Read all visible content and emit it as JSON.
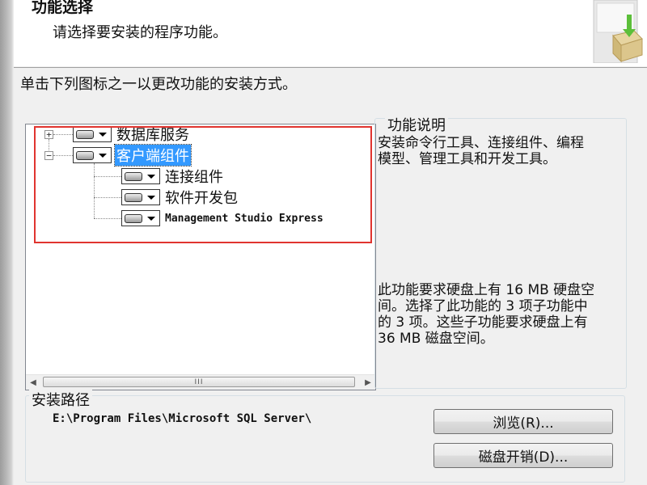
{
  "header": {
    "title": "功能选择",
    "subtitle": "请选择要安装的程序功能。"
  },
  "instruction": "单击下列图标之一以更改功能的安装方式。",
  "tree": {
    "nodes": [
      {
        "label": "数据库服务",
        "expander": "+"
      },
      {
        "label": "客户端组件",
        "expander": "−"
      },
      {
        "label": "连接组件"
      },
      {
        "label": "软件开发包"
      },
      {
        "label": "Management Studio Express"
      }
    ],
    "scrollbar": {
      "left_arrow": "◀",
      "right_arrow": "▶",
      "thumb_grip": "III"
    }
  },
  "description": {
    "caption": "功能说明",
    "text_lines": [
      "安装命令行工具、连接组件、编程",
      "模型、管理工具和开发工具。"
    ],
    "disk_lines": [
      "此功能要求硬盘上有 16 MB 硬盘空",
      "间。选择了此功能的 3 项子功能中",
      "的 3 项。这些子功能要求硬盘上有",
      "36 MB 磁盘空间。"
    ]
  },
  "install_path": {
    "caption": "安装路径",
    "value": "E:\\Program Files\\Microsoft SQL Server\\"
  },
  "buttons": {
    "browse": "浏览(R)...",
    "disk_cost": "磁盘开销(D)..."
  },
  "colors": {
    "highlight": "#e0342f",
    "selection": "#3399ff"
  }
}
